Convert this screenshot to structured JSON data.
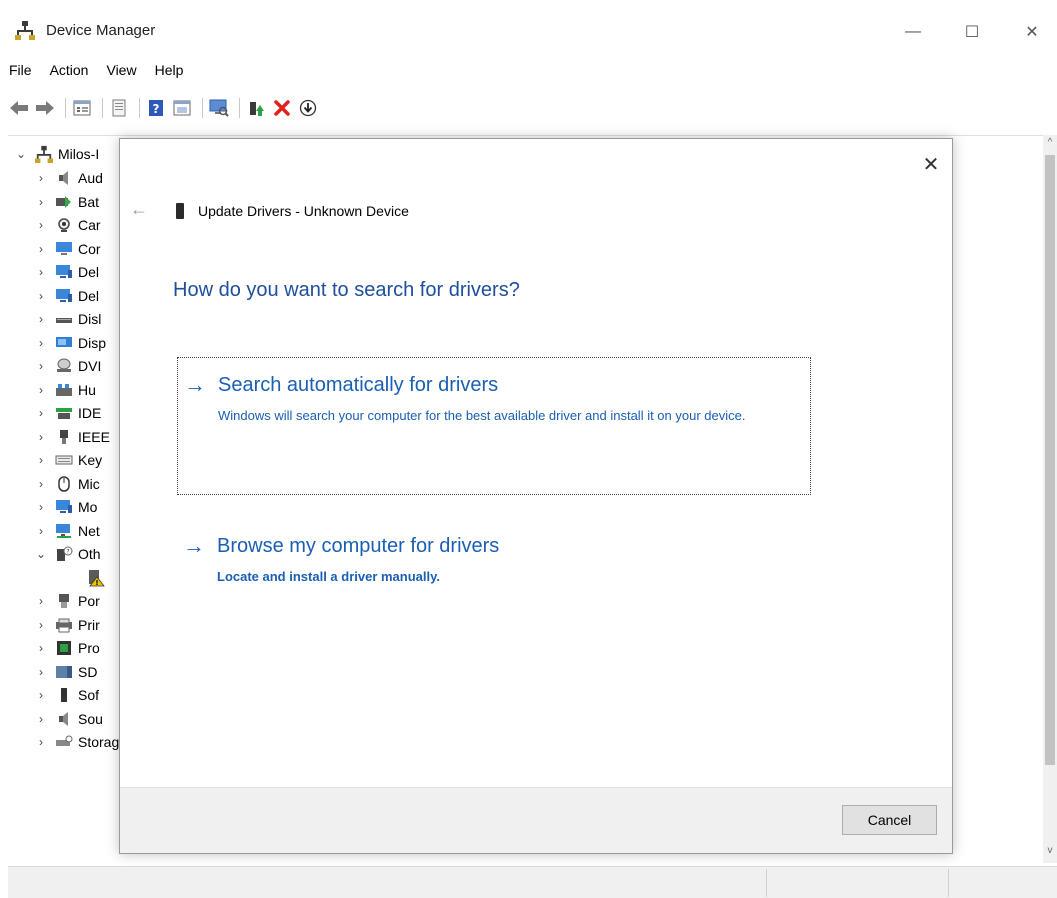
{
  "window": {
    "title": "Device Manager",
    "controls": {
      "minimize": "—",
      "maximize": "☐",
      "close": "✕"
    }
  },
  "menu": [
    "File",
    "Action",
    "View",
    "Help"
  ],
  "toolbar": {
    "buttons": [
      "back-icon",
      "forward-icon",
      "properties-icon",
      "show-hidden-icon",
      "help-icon",
      "view-icon",
      "scan-hardware-icon",
      "update-driver-icon",
      "uninstall-icon",
      "download-icon"
    ]
  },
  "tree": {
    "root": "Milos-I",
    "items": [
      {
        "label": "Aud",
        "icon": "speaker-icon"
      },
      {
        "label": "Bat",
        "icon": "battery-icon"
      },
      {
        "label": "Car",
        "icon": "camera-icon"
      },
      {
        "label": "Cor",
        "icon": "computer-icon"
      },
      {
        "label": "Del",
        "icon": "monitor-icon"
      },
      {
        "label": "Del",
        "icon": "monitor-icon"
      },
      {
        "label": "Disl",
        "icon": "disk-icon"
      },
      {
        "label": "Disp",
        "icon": "display-icon"
      },
      {
        "label": "DVI",
        "icon": "dvd-icon"
      },
      {
        "label": "Hu",
        "icon": "hid-icon"
      },
      {
        "label": "IDE",
        "icon": "ide-icon"
      },
      {
        "label": "IEEE",
        "icon": "ieee-icon"
      },
      {
        "label": "Key",
        "icon": "keyboard-icon"
      },
      {
        "label": "Mic",
        "icon": "mouse-icon"
      },
      {
        "label": "Mo",
        "icon": "monitor-icon"
      },
      {
        "label": "Net",
        "icon": "network-icon"
      },
      {
        "label": "Oth",
        "icon": "unknown-device-icon"
      },
      {
        "label": "",
        "icon": "warning-device-icon"
      },
      {
        "label": "Por",
        "icon": "port-icon"
      },
      {
        "label": "Prir",
        "icon": "printer-icon"
      },
      {
        "label": "Pro",
        "icon": "processor-icon"
      },
      {
        "label": "SD",
        "icon": "sd-icon"
      },
      {
        "label": "Sof",
        "icon": "software-icon"
      },
      {
        "label": "Sou",
        "icon": "sound-icon"
      },
      {
        "label": "Storage controllers",
        "icon": "storage-icon"
      }
    ]
  },
  "dialog": {
    "close": "✕",
    "back": "←",
    "title": "Update Drivers - Unknown Device",
    "question": "How do you want to search for drivers?",
    "options": [
      {
        "title": "Search automatically for drivers",
        "description": "Windows will search your computer for the best available driver and install it on your device."
      },
      {
        "title": "Browse my computer for drivers",
        "description": "Locate and install a driver manually."
      }
    ],
    "cancel": "Cancel"
  },
  "colors": {
    "link_blue": "#1a5fb4",
    "heading_blue": "#1e4e9c"
  }
}
